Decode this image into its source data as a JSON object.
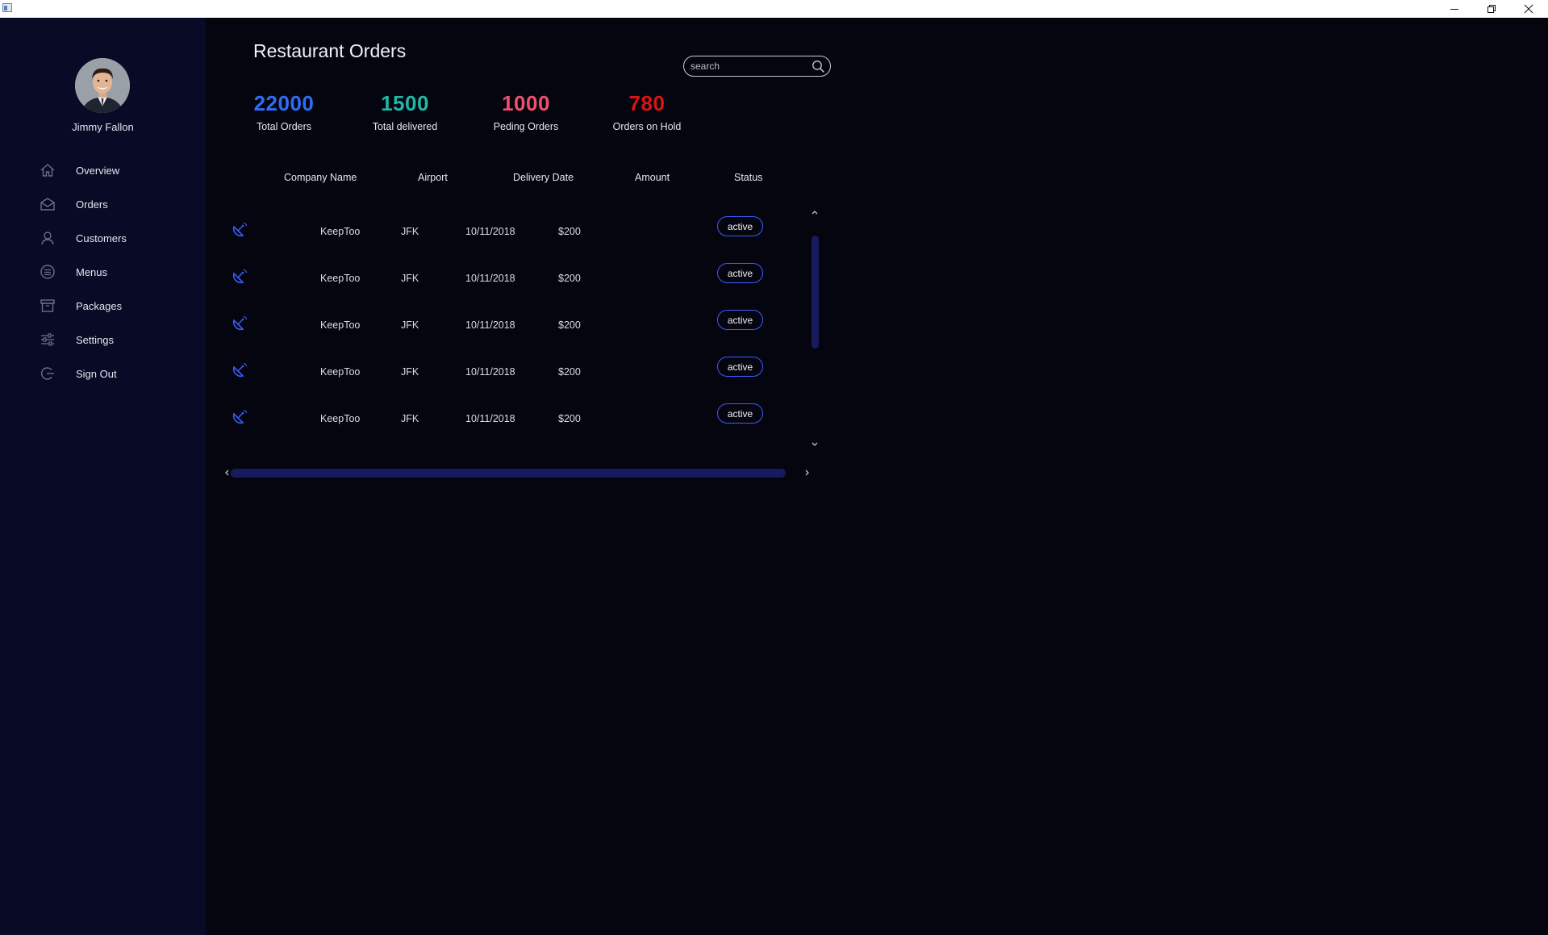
{
  "window": {
    "icon": "window-app-icon",
    "controls": [
      "minimize-icon",
      "restore-icon",
      "close-icon"
    ]
  },
  "profile": {
    "name": "Jimmy Fallon",
    "avatar": "avatar-photo"
  },
  "nav": [
    {
      "label": "Overview",
      "icon": "home-icon"
    },
    {
      "label": "Orders",
      "icon": "envelope-icon"
    },
    {
      "label": "Customers",
      "icon": "user-icon"
    },
    {
      "label": "Menus",
      "icon": "list-circle-icon"
    },
    {
      "label": "Packages",
      "icon": "archive-box-icon"
    },
    {
      "label": "Settings",
      "icon": "sliders-icon"
    },
    {
      "label": "Sign Out",
      "icon": "sign-out-icon"
    }
  ],
  "header": {
    "title": "Restaurant Orders",
    "search_placeholder": "search"
  },
  "stats": [
    {
      "value": "22000",
      "label": "Total Orders",
      "color": "#2f6df6"
    },
    {
      "value": "1500",
      "label": "Total delivered",
      "color": "#1fb8a8"
    },
    {
      "value": "1000",
      "label": "Peding Orders",
      "color": "#f0506e"
    },
    {
      "value": "780",
      "label": "Orders on Hold",
      "color": "#d91414"
    }
  ],
  "table": {
    "columns": [
      "Company Name",
      "Airport",
      "Delivery Date",
      "Amount",
      "Status"
    ],
    "rows": [
      {
        "company": "KeepToo",
        "airport": "JFK",
        "date": "10/11/2018",
        "amount": "$200",
        "status": "active"
      },
      {
        "company": "KeepToo",
        "airport": "JFK",
        "date": "10/11/2018",
        "amount": "$200",
        "status": "active"
      },
      {
        "company": "KeepToo",
        "airport": "JFK",
        "date": "10/11/2018",
        "amount": "$200",
        "status": "active"
      },
      {
        "company": "KeepToo",
        "airport": "JFK",
        "date": "10/11/2018",
        "amount": "$200",
        "status": "active"
      },
      {
        "company": "KeepToo",
        "airport": "JFK",
        "date": "10/11/2018",
        "amount": "$200",
        "status": "active"
      }
    ],
    "row_icon": "satellite-dish-icon",
    "accent_color": "#3a5cff"
  },
  "colors": {
    "sidebar_bg": "#080a26",
    "main_bg": "#05050f",
    "scroll_thumb": "#171b5e"
  }
}
